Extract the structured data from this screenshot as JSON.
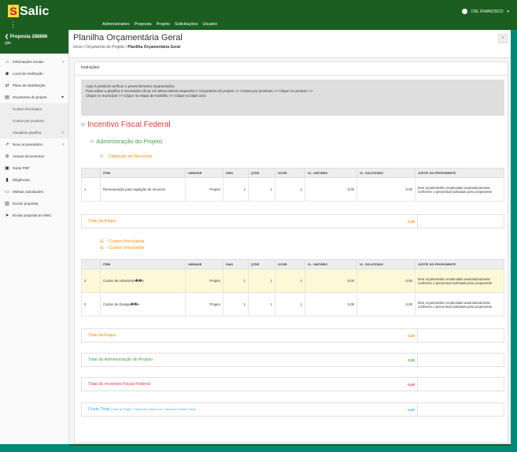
{
  "app": {
    "name": "Salic",
    "logo_letter": "S",
    "menu_icon": "menu-dots-icon"
  },
  "topnav": [
    "Administrativo",
    "Proposta",
    "Projeto",
    "Solicitações",
    "Usuário"
  ],
  "user": {
    "name": "DSL FRANCISCO",
    "icon": "user-icon"
  },
  "sidebar": {
    "project_title": "Proposta 288866",
    "project_sub": "ção",
    "items": [
      {
        "label": "Informações iniciais",
        "icon": "home-icon",
        "chev": "‹"
      },
      {
        "label": "Local de realização",
        "icon": "location-icon",
        "chev": ""
      },
      {
        "label": "Plano de distribuição",
        "icon": "share-icon",
        "chev": ""
      },
      {
        "label": "Orçamento do projeto",
        "icon": "budget-icon",
        "chev": "▾"
      }
    ],
    "subitems": [
      {
        "label": "Custos Vinculados",
        "chev": ""
      },
      {
        "label": "Custos por produtos",
        "chev": ""
      },
      {
        "label": "Visualizar planilha",
        "chev": "›"
      }
    ],
    "items2": [
      {
        "label": "Novo orçamentário",
        "icon": "chart-icon",
        "chev": "‹"
      },
      {
        "label": "Anexar documentos",
        "icon": "attach-icon",
        "chev": ""
      },
      {
        "label": "Gerar PDF",
        "icon": "pdf-icon",
        "chev": ""
      },
      {
        "label": "Diligências",
        "icon": "book-icon",
        "chev": ""
      },
      {
        "label": "Minhas solicitações",
        "icon": "inbox-icon",
        "chev": ""
      },
      {
        "label": "Excluir proposta",
        "icon": "trash-icon",
        "chev": ""
      },
      {
        "label": "Enviar proposta ao MinC",
        "icon": "send-icon",
        "chev": ""
      }
    ]
  },
  "header": {
    "title": "Planilha Orçamentária Geral",
    "breadcrumb_prefix": "Início / Orçamento do Projeto / ",
    "breadcrumb_current": "Planilha Orçamentária Geral",
    "close": "×"
  },
  "instructions": {
    "title": "Instruções",
    "line1": "Aqui é possível verificar o preenchimento orçamentário.",
    "line2": "Para editar a planilha é necessário clicar em Menu lateral esquerdo>> Orçamento do projeto >> Custos por produtos >> Clique no produto >>",
    "line3": "Clique no município >> Clique na etapa de trabalho >> Clique no lápis azul"
  },
  "sections": {
    "h1": "Incentivo Fiscal Federal",
    "h2": "Administração do Projeto",
    "h3": "- Captação de Recursos",
    "h3b": "- Custos Vinculados",
    "h3c": "- Custos Vinculados",
    "marker": "⊟"
  },
  "columns": [
    "ITEM",
    "UNIDADE",
    "DIAS",
    "QTDE",
    "OCOR.",
    "VL. UNITÁRIO",
    "VL. SOLICITADO",
    "JUSTIF. DO PROPONENTE"
  ],
  "table1": [
    {
      "n": "1",
      "item": "Remuneração para captação de recursos",
      "unidade": "Projeto",
      "dias": "1",
      "qtde": "1",
      "ocor": "1",
      "unit": "0,00",
      "sol": "0,00",
      "just": "Item orçamentário recalculado automaticamente conforme o percentual solicitado pelo proponente"
    }
  ],
  "table2": [
    {
      "n": "2",
      "item": "Custos de Administra��o",
      "unidade": "Projeto",
      "dias": "1",
      "qtde": "1",
      "ocor": "1",
      "unit": "0,00",
      "sol": "0,00",
      "just": "Item orçamentário recalculado automaticamente conforme o percentual solicitado pelo proponente"
    },
    {
      "n": "3",
      "item": "Custos de Divulga��o",
      "unidade": "Projeto",
      "dias": "1",
      "qtde": "1",
      "ocor": "1",
      "unit": "0,00",
      "sol": "0,00",
      "just": "Item orçamentário recalculado automaticamente conforme o percentual solicitado pelo proponente"
    }
  ],
  "totals": {
    "etapa1": {
      "label": "Total da Etapa",
      "value": "0,00"
    },
    "etapa2": {
      "label": "Total da Etapa",
      "value": "0,00"
    },
    "admin": {
      "label": "Total da Administração do Projeto",
      "value": "0,00"
    },
    "incentivo": {
      "label": "Total do Incentivo Fiscal Federal",
      "value": "0,00"
    },
    "custo": {
      "label": "Custo Total",
      "note": "(Custo do Projeto + Valores de Outras Leis + Valores de Outras Fontes)",
      "value": "0,00"
    }
  },
  "colors": {
    "red": "#e53935",
    "green": "#43a047",
    "orange": "#fb8c00",
    "blue": "#42a5f5",
    "brand": "#1b5e20"
  }
}
